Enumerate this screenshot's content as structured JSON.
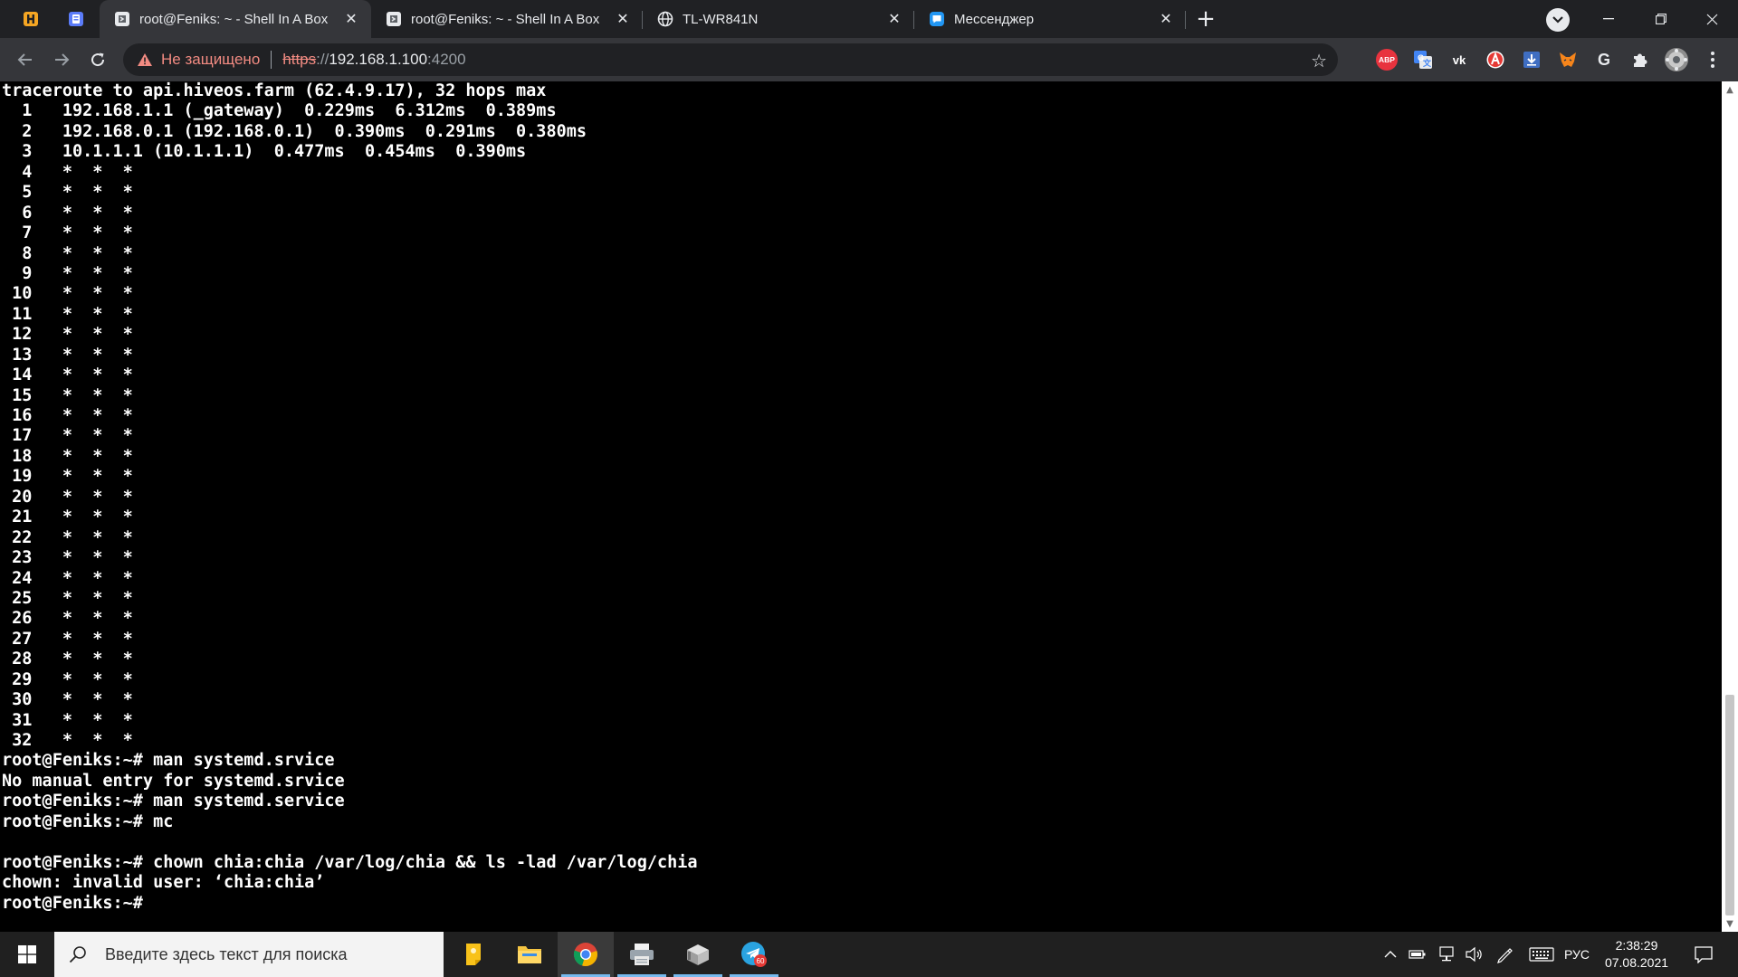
{
  "browser": {
    "tabs": [
      {
        "title": "root@Feniks: ~ - Shell In A Box",
        "active": true,
        "icon": "shellinabox-icon"
      },
      {
        "title": "root@Feniks: ~ - Shell In A Box",
        "active": false,
        "icon": "shellinabox-icon"
      },
      {
        "title": "TL-WR841N",
        "active": false,
        "icon": "globe-icon"
      },
      {
        "title": "Мессенджер",
        "active": false,
        "icon": "messenger-icon"
      }
    ],
    "address": {
      "security_status": "Не защищено",
      "scheme": "https",
      "separator": "://",
      "host": "192.168.1.100",
      "port": ":4200"
    },
    "extensions": [
      "adblock-icon",
      "translate-icon",
      "vk-icon",
      "antivirus-icon",
      "download-icon",
      "metamask-icon",
      "google-icon",
      "puzzle-icon",
      "profile-avatar"
    ],
    "extension_labels": {
      "adblock": "ABP",
      "vk": "vk",
      "google": "G"
    }
  },
  "terminal": {
    "lines": [
      "traceroute to api.hiveos.farm (62.4.9.17), 32 hops max",
      "  1   192.168.1.1 (_gateway)  0.229ms  6.312ms  0.389ms",
      "  2   192.168.0.1 (192.168.0.1)  0.390ms  0.291ms  0.380ms",
      "  3   10.1.1.1 (10.1.1.1)  0.477ms  0.454ms  0.390ms",
      "  4   *  *  *",
      "  5   *  *  *",
      "  6   *  *  *",
      "  7   *  *  *",
      "  8   *  *  *",
      "  9   *  *  *",
      " 10   *  *  *",
      " 11   *  *  *",
      " 12   *  *  *",
      " 13   *  *  *",
      " 14   *  *  *",
      " 15   *  *  *",
      " 16   *  *  *",
      " 17   *  *  *",
      " 18   *  *  *",
      " 19   *  *  *",
      " 20   *  *  *",
      " 21   *  *  *",
      " 22   *  *  *",
      " 23   *  *  *",
      " 24   *  *  *",
      " 25   *  *  *",
      " 26   *  *  *",
      " 27   *  *  *",
      " 28   *  *  *",
      " 29   *  *  *",
      " 30   *  *  *",
      " 31   *  *  *",
      " 32   *  *  *",
      "root@Feniks:~# man systemd.srvice",
      "No manual entry for systemd.srvice",
      "root@Feniks:~# man systemd.service",
      "root@Feniks:~# mc",
      "",
      "root@Feniks:~# chown chia:chia /var/log/chia && ls -lad /var/log/chia",
      "chown: invalid user: ‘chia:chia’",
      "root@Feniks:~# "
    ],
    "scroll_position": 0.9
  },
  "taskbar": {
    "search_placeholder": "Введите здесь текст для поиска",
    "apps": [
      "sticky-notes-icon",
      "file-explorer-icon",
      "chrome-icon",
      "printer-app-icon",
      "package-app-icon",
      "telegram-icon"
    ],
    "telegram_badge": "60",
    "language": "РУС",
    "time": "2:38:29",
    "date": "07.08.2021"
  }
}
